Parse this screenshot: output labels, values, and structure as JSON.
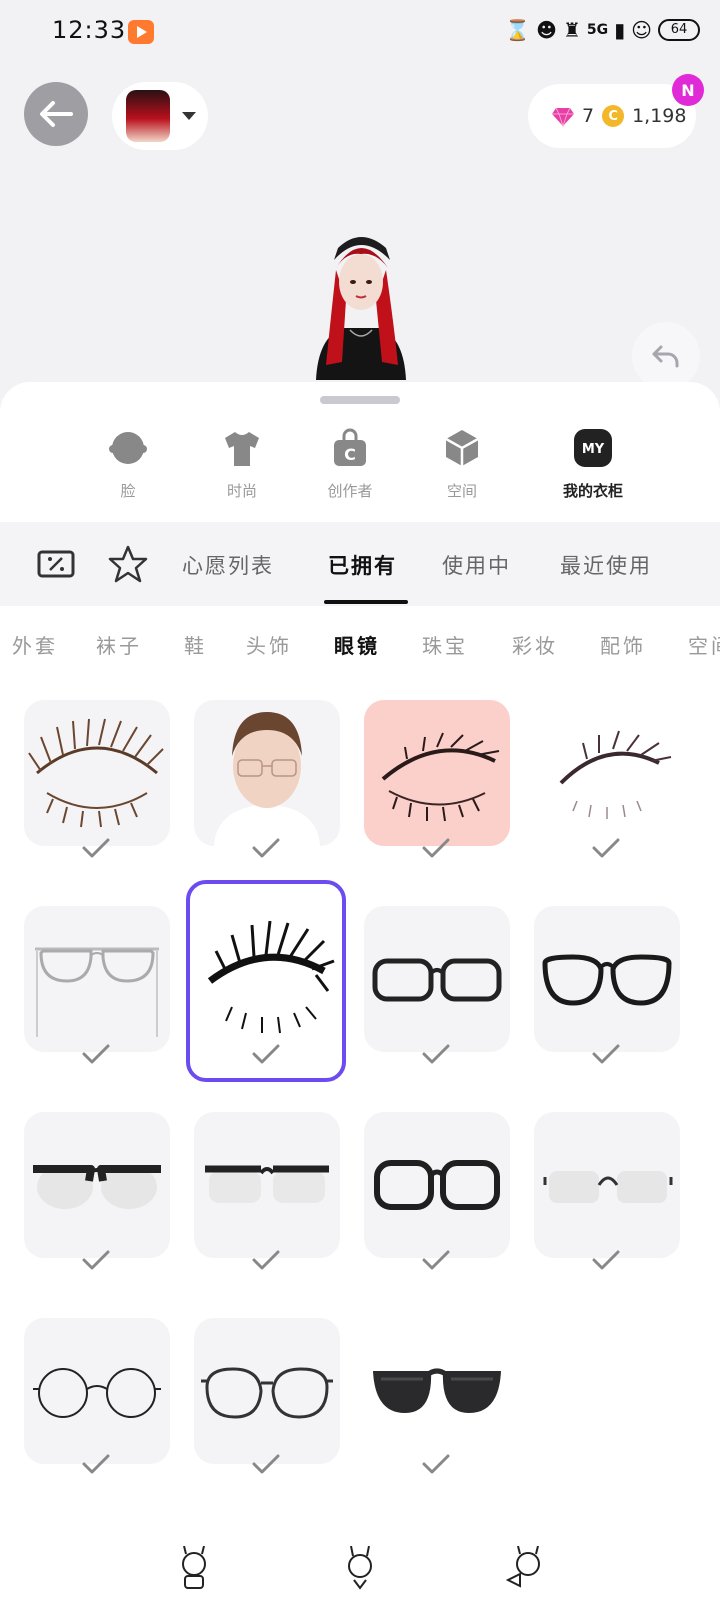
{
  "status_bar": {
    "time": "12:33",
    "network": "5G",
    "battery": "64"
  },
  "header": {
    "diamonds": "7",
    "coins": "1,198",
    "badge": "N"
  },
  "categories": [
    {
      "label": "脸",
      "icon": "face-icon"
    },
    {
      "label": "时尚",
      "icon": "tshirt-icon"
    },
    {
      "label": "创作者",
      "icon": "creator-bag-icon"
    },
    {
      "label": "空间",
      "icon": "space-cube-icon"
    },
    {
      "label": "我的衣柜",
      "icon": "my-closet-icon",
      "badge": "MY"
    }
  ],
  "sub_tabs": [
    "心愿列表",
    "已拥有",
    "使用中",
    "最近使用"
  ],
  "item_types": [
    "外套",
    "袜子",
    "鞋",
    "头饰",
    "眼镜",
    "珠宝",
    "彩妆",
    "配饰",
    "空间"
  ],
  "selected_category": "我的衣柜",
  "selected_sub_tab": "已拥有",
  "selected_item_type": "眼镜",
  "items": [
    {
      "name": "eyelash-brown"
    },
    {
      "name": "glasses-on-avatar"
    },
    {
      "name": "eyelash-pink-bg"
    },
    {
      "name": "eyelash-dark-fade"
    },
    {
      "name": "glasses-aviator-silver"
    },
    {
      "name": "eyelash-black-bold",
      "selected": true
    },
    {
      "name": "glasses-rect-black"
    },
    {
      "name": "glasses-round-black"
    },
    {
      "name": "glasses-browline-black"
    },
    {
      "name": "glasses-half-rim-black"
    },
    {
      "name": "glasses-wayfarer-black"
    },
    {
      "name": "glasses-clear-bridge"
    },
    {
      "name": "glasses-round-thin"
    },
    {
      "name": "glasses-round-metal"
    },
    {
      "name": "sunglasses-black"
    }
  ],
  "colors": {
    "accent": "#6c4cf0",
    "badge": "#e02ad8",
    "coin": "#f2b82a",
    "gem": "#e63fa8"
  }
}
